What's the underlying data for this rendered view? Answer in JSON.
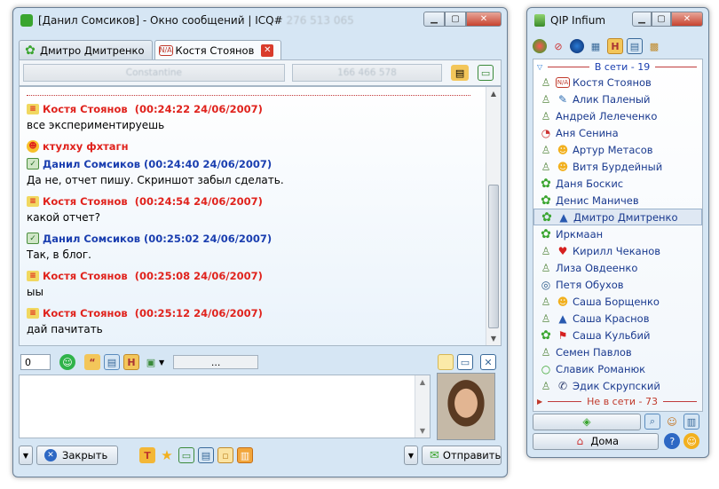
{
  "msg_window": {
    "title": "[Данил Сомсиков] - Окно сообщений | ICQ#",
    "title_masked": "276 513 065",
    "tabs": [
      {
        "label": "Дмитро Дмитренко",
        "icon": "green-flower-icon"
      },
      {
        "label": "Костя Стоянов",
        "icon": "na-status-icon",
        "active": true
      }
    ],
    "info": {
      "nick": "Constantine",
      "uin": "166 466 578"
    },
    "messages": [
      {
        "author": "Костя Стоянов",
        "time": "(00:24:22 24/06/2007)",
        "text": "все экспериментируешь",
        "side": "in"
      },
      {
        "author": "ктулху фхтагн",
        "time": "",
        "text": "",
        "side": "status"
      },
      {
        "author": "Данил Сомсиков",
        "time": "(00:24:40 24/06/2007)",
        "text": "Да не, отчет пишу. Скриншот забыл сделать.",
        "side": "out"
      },
      {
        "author": "Костя Стоянов",
        "time": "(00:24:54 24/06/2007)",
        "text": "какой отчет?",
        "side": "in"
      },
      {
        "author": "Данил Сомсиков",
        "time": "(00:25:02 24/06/2007)",
        "text": "Так, в блог.",
        "side": "out"
      },
      {
        "author": "Костя Стоянов",
        "time": "(00:25:08 24/06/2007)",
        "text": "ыы",
        "side": "in"
      },
      {
        "author": "Костя Стоянов",
        "time": "(00:25:12 24/06/2007)",
        "text": "дай пачитать",
        "side": "in"
      }
    ],
    "char_counter": "0",
    "status_field": "...",
    "close_label": "Закрыть",
    "send_label": "Отправить"
  },
  "qip": {
    "title": "QIP Infium",
    "online_group": "В сети - 19",
    "offline_group": "Не в сети - 73",
    "contacts": [
      {
        "name": "Костя Стоянов",
        "icon": "na-status-icon"
      },
      {
        "name": "Алик Паленый",
        "icon": "person-icon"
      },
      {
        "name": "Андрей Лелеченко",
        "icon": "none"
      },
      {
        "name": "Аня Сенина",
        "icon": "none"
      },
      {
        "name": "Артур Метасов",
        "icon": "smiley-icon"
      },
      {
        "name": "Витя Бурдейный",
        "icon": "smiley-icon"
      },
      {
        "name": "Даня Боскис",
        "icon": "none"
      },
      {
        "name": "Денис Маничев",
        "icon": "none"
      },
      {
        "name": "Дмитро Дмитренко",
        "icon": "grad-cap-icon",
        "selected": true
      },
      {
        "name": "Иркмаан",
        "icon": "none"
      },
      {
        "name": "Кирилл Чеканов",
        "icon": "heart-icon"
      },
      {
        "name": "Лиза Овдеенко",
        "icon": "none"
      },
      {
        "name": "Петя Обухов",
        "icon": "none"
      },
      {
        "name": "Саша Борщенко",
        "icon": "smiley-icon"
      },
      {
        "name": "Саша Краснов",
        "icon": "grad-cap-icon"
      },
      {
        "name": "Саша Кульбий",
        "icon": "flag-icon"
      },
      {
        "name": "Семен Павлов",
        "icon": "none"
      },
      {
        "name": "Славик Романюк",
        "icon": "none"
      },
      {
        "name": "Эдик Скрупский",
        "icon": "phone-icon"
      }
    ],
    "status_label": "Дома"
  },
  "colors": {
    "incoming": "#e0231d",
    "outgoing": "#1b3fb0",
    "contact": "#1a3a8f"
  }
}
